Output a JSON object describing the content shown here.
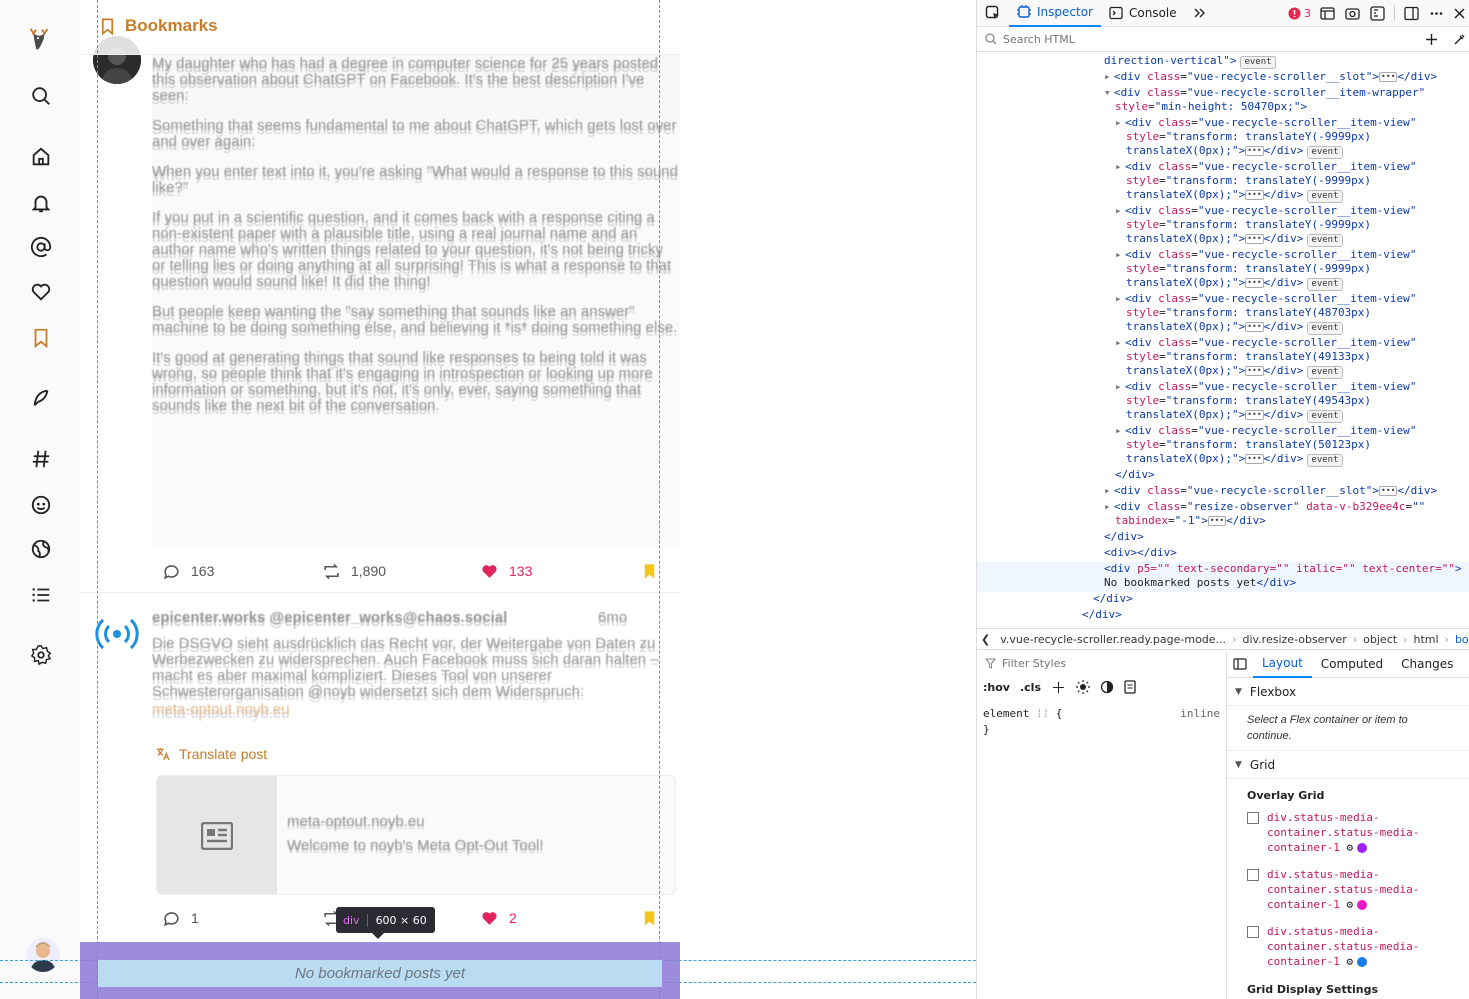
{
  "main": {
    "header_title": "Bookmarks",
    "empty_message": "No bookmarked posts yet",
    "post1": {
      "text_paragraphs": [
        "My daughter who has had a degree in computer science for 25 years posted this observation about ChatGPT on Facebook. It's the best description I've seen:",
        "Something that seems fundamental to me about ChatGPT, which gets lost over and over again:",
        "When you enter text into it, you're asking \"What would a response to this sound like?\"",
        "If you put in a scientific question, and it comes back with a response citing a non-existent paper with a plausible title, using a real journal name and an author name who's written things related to your question, it's not being tricky or telling lies or doing anything at all surprising! This is what a response to that question would sound like! It did the thing!",
        "But people keep wanting the \"say something that sounds like an answer\" machine to be doing something else, and believing it *is* doing something else.",
        "It's good at generating things that sound like responses to being told it was wrong, so people think that it's engaging in introspection or looking up more information or something, but it's not, it's only, ever, saying something that sounds like the next bit of the conversation."
      ],
      "replies": "163",
      "boosts": "1,890",
      "likes": "133"
    },
    "post2": {
      "author": "epicenter.works @epicenter_works@chaos.social",
      "time": "6mo",
      "text": "Die DSGVO sieht ausdrücklich das Recht vor, der Weitergabe von Daten zu Werbezwecken zu widersprechen. Auch Facebook muss sich daran halten – macht es aber maximal kompliziert. Dieses Tool von unserer Schwesterorganisation @noyb widersetzt sich dem Widerspruch:",
      "link": "meta-optout.noyb.eu",
      "translate_label": "Translate post",
      "card_domain": "meta-optout.noyb.eu",
      "card_title": "Welcome to noyb's Meta Opt-Out Tool!",
      "replies": "1",
      "likes": "2"
    },
    "tooltip_tag": "div",
    "tooltip_dims": "600 × 60"
  },
  "devtools": {
    "tabs": {
      "inspector": "Inspector",
      "console": "Console"
    },
    "error_count": "3",
    "search_placeholder": "Search HTML",
    "tree": {
      "l0": "direction-vertical\">",
      "slot": "vue-recycle-scroller__slot",
      "wrapper": "vue-recycle-scroller__item-wrapper",
      "wrapper_style": "min-height: 50470px;",
      "item_view": "vue-recycle-scroller__item-view",
      "items": [
        "transform: translateY(-9999px)",
        "transform: translateY(-9999px)",
        "transform: translateY(-9999px)",
        "transform: translateY(-9999px)",
        "transform: translateY(48703px)",
        "transform: translateY(49133px)",
        "transform: translateY(49543px)",
        "transform: translateY(50123px)"
      ],
      "translatex": "translateX(0px);\">",
      "resize_class": "resize-observer",
      "resize_attr": "data-v-b329ee4c",
      "tabindex": "-1",
      "sel_attrs": "p5=\"\" text-secondary=\"\" italic=\"\" text-center=\"\"",
      "sel_text": "No bookmarked posts yet",
      "event": "event"
    },
    "breadcrumbs": [
      "v.vue-recycle-scroller.ready.page-mode...",
      "div.resize-observer",
      "object",
      "html",
      "body"
    ],
    "filter_placeholder": "Filter Styles",
    "rule_tools": [
      ":hov",
      ".cls"
    ],
    "rule_selector": "element",
    "rule_origin": "inline",
    "layout_tabs": [
      "Layout",
      "Computed",
      "Changes"
    ],
    "flexbox_title": "Flexbox",
    "flexbox_msg": "Select a Flex container or item to continue.",
    "grid_title": "Grid",
    "overlay_grid": "Overlay Grid",
    "grid_items": [
      {
        "name": "div.status-media-container.status-media-container-1",
        "color": "#9b21f5"
      },
      {
        "name": "div.status-media-container.status-media-container-1",
        "color": "#e81ac8"
      },
      {
        "name": "div.status-media-container.status-media-container-1",
        "color": "#1a7ee8"
      }
    ],
    "grid_display_settings": "Grid Display Settings"
  },
  "colors": {
    "accent": "#c77d2a",
    "like": "#e0245e",
    "bookmark": "#f5c518",
    "devtools_accent": "#0a84ff"
  }
}
